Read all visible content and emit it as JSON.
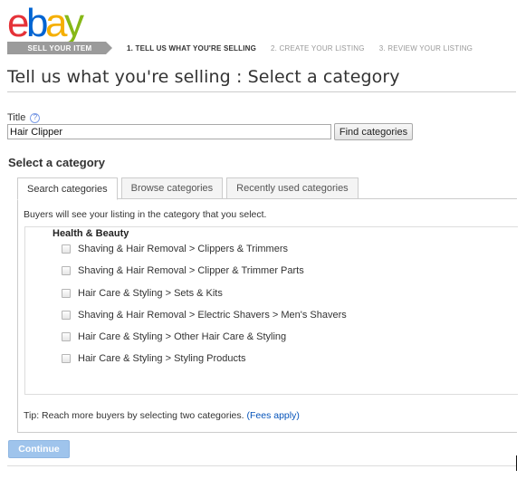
{
  "logo": {
    "letters": [
      "e",
      "b",
      "a",
      "y"
    ],
    "colors": [
      "#e53238",
      "#0064d2",
      "#f5af02",
      "#86b817"
    ]
  },
  "progress": {
    "current_badge": "SELL YOUR ITEM",
    "steps": [
      {
        "label": "1. TELL US WHAT YOU'RE SELLING",
        "active": true
      },
      {
        "label": "2. CREATE YOUR LISTING",
        "active": false
      },
      {
        "label": "3. REVIEW YOUR LISTING",
        "active": false
      }
    ]
  },
  "page_title": "Tell us what you're selling : Select a category",
  "title_field": {
    "label": "Title",
    "help_icon": "?",
    "value": "Hair Clipper"
  },
  "find_button": "Find categories",
  "section_heading": "Select a category",
  "tabs": [
    {
      "label": "Search categories",
      "selected": true
    },
    {
      "label": "Browse categories",
      "selected": false
    },
    {
      "label": "Recently used categories",
      "selected": false
    }
  ],
  "panel": {
    "intro": "Buyers will see your listing in the category that you select.",
    "group_title": "Health & Beauty",
    "categories": [
      "Shaving & Hair Removal > Clippers & Trimmers",
      "Shaving & Hair Removal > Clipper & Trimmer Parts",
      "Hair Care & Styling > Sets & Kits",
      "Shaving & Hair Removal > Electric Shavers > Men's Shavers",
      "Hair Care & Styling > Other Hair Care & Styling",
      "Hair Care & Styling > Styling Products"
    ],
    "tip_text": "Tip: Reach more buyers by selecting two categories.",
    "tip_link": "(Fees apply)"
  },
  "continue_button": "Continue",
  "colors": {
    "link": "#0654ba",
    "continue_bg": "#9fc4ec",
    "badge_bg": "#9b9b9b"
  }
}
